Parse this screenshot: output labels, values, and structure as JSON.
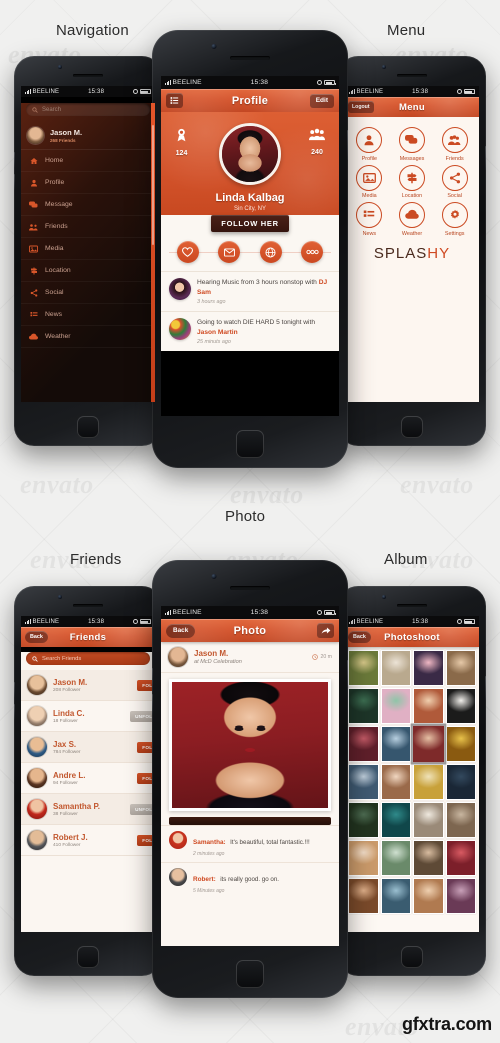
{
  "captions": {
    "navigation": "Navigation",
    "menu": "Menu",
    "photo": "Photo",
    "friends": "Friends",
    "album": "Album"
  },
  "watermark": {
    "envato": "envato",
    "footer": "gfxtra.com"
  },
  "colors": {
    "accent": "#d2522a",
    "accent_dark": "#c2441f",
    "accent_light": "#e2663a",
    "app_bg": "#fbf6f1",
    "dark_btn": "#3b1810",
    "page_bg": "#f0f0ef"
  },
  "status_bar": {
    "carrier": "BEELINE",
    "time": "15:38"
  },
  "profile_screen": {
    "nav": {
      "title": "Profile",
      "menu_icon": "list-icon",
      "edit_label": "Edit"
    },
    "stats": [
      {
        "icon": "award-icon",
        "value": "124"
      },
      {
        "icon": "people-icon",
        "value": "240"
      }
    ],
    "name": "Linda Kalbag",
    "location": "Sin City, NY",
    "follow_label": "FOLLOW HER",
    "actions": [
      {
        "icon": "heart-icon"
      },
      {
        "icon": "envelope-icon"
      },
      {
        "icon": "globe-icon"
      },
      {
        "icon": "more-icon"
      }
    ],
    "feed": [
      {
        "text_before": "Hearing Music from 3 hours nonstop with ",
        "highlight": "DJ Sam",
        "time": "3 hours ago"
      },
      {
        "text_before": "Going to watch DIE HARD 5 tonight with ",
        "highlight": "Jason Martin",
        "time": "25 minuts ago"
      }
    ]
  },
  "navigation_screen": {
    "search_placeholder": "Search",
    "user": {
      "name": "Jason M.",
      "friends": "268 Friends"
    },
    "items": [
      {
        "label": "Home",
        "icon": "home-icon"
      },
      {
        "label": "Profile",
        "icon": "user-icon"
      },
      {
        "label": "Message",
        "icon": "chat-icon"
      },
      {
        "label": "Friends",
        "icon": "people-icon"
      },
      {
        "label": "Media",
        "icon": "image-icon"
      },
      {
        "label": "Location",
        "icon": "signpost-icon"
      },
      {
        "label": "Social",
        "icon": "share-icon"
      },
      {
        "label": "News",
        "icon": "list-icon"
      },
      {
        "label": "Weather",
        "icon": "cloud-icon"
      }
    ]
  },
  "menu_screen": {
    "nav": {
      "title": "Menu",
      "logout_label": "Logout"
    },
    "tiles": [
      {
        "label": "Profile",
        "icon": "user-icon"
      },
      {
        "label": "Messages",
        "icon": "chat-icon"
      },
      {
        "label": "Friends",
        "icon": "people-icon"
      },
      {
        "label": "Media",
        "icon": "image-icon"
      },
      {
        "label": "Location",
        "icon": "signpost-icon"
      },
      {
        "label": "Social",
        "icon": "share-icon"
      },
      {
        "label": "News",
        "icon": "list-icon"
      },
      {
        "label": "Weather",
        "icon": "cloud-icon"
      },
      {
        "label": "Settings",
        "icon": "gear-icon"
      }
    ],
    "brand": {
      "part1": "SPLAS",
      "part2": "HY"
    }
  },
  "friends_screen": {
    "nav": {
      "title": "Friends",
      "back_label": "Back"
    },
    "search_placeholder": "Search Friends",
    "rows": [
      {
        "name": "Jason M.",
        "followers": "208 Follower",
        "action": "FOLLOW"
      },
      {
        "name": "Linda C.",
        "followers": "18 Follower",
        "action": "UNFOLLOW"
      },
      {
        "name": "Jax S.",
        "followers": "784 Follower",
        "action": "FOLLOW"
      },
      {
        "name": "Andre L.",
        "followers": "94 Follower",
        "action": "FOLLOW"
      },
      {
        "name": "Samantha P.",
        "followers": "38 Follower",
        "action": "UNFOLLOW"
      },
      {
        "name": "Robert J.",
        "followers": "410 Follower",
        "action": "FOLLOW"
      }
    ]
  },
  "photo_screen": {
    "nav": {
      "title": "Photo",
      "back_label": "Back",
      "share_icon": "share-arrow-icon"
    },
    "author": "Jason M.",
    "place": "at McD Celebration",
    "time": "20 m",
    "comments": [
      {
        "name": "Samantha:",
        "text": "It's beautiful, total fantastic.!!!",
        "time": "2 minutes ago"
      },
      {
        "name": "Robert:",
        "text": "its really good. go on.",
        "time": "5 Minutes ago"
      }
    ]
  },
  "album_screen": {
    "nav": {
      "title": "Photoshoot",
      "back_label": "Back"
    },
    "selected_index": 10,
    "thumb_count": 28
  }
}
